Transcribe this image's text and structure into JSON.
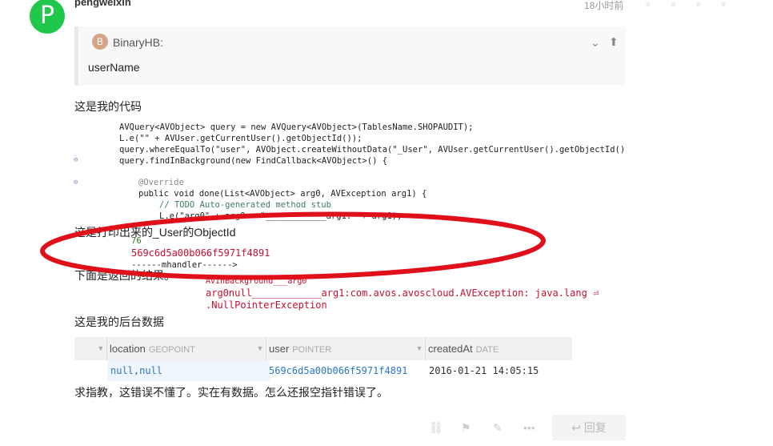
{
  "post": {
    "avatar_letter": "P",
    "username": "pengweixin",
    "timestamp": "18小时前",
    "quote": {
      "avatar_letter": "B",
      "author": "BinaryHB:",
      "body": "userName"
    },
    "para1": "这是我的代码",
    "code_lines": [
      "AVQuery<AVObject> query = new AVQuery<AVObject>(TablesName.SHOPAUDIT);",
      "L.e(\"\" + AVUser.getCurrentUser().getObjectId());",
      "query.whereEqualTo(\"user\", AVObject.createWithoutData(\"_User\", AVUser.getCurrentUser().getObjectId()));",
      "query.findInBackground(new FindCallback<AVObject>() {",
      "@Override",
      "public void done(List<AVObject> arg0, AVException arg1) {",
      "// TODO Auto-generated method stub",
      "L.e(\"arg0\" + arg0 + \"____________arg1:\" + arg1);"
    ],
    "para2": "这是打印出来的_User的ObjectId",
    "log_number": "76",
    "log_objectid": "569c6d5a00b066f5971f4891",
    "log_handler": "------mhandler------>",
    "para3": "下面是返回的结果。",
    "log_arg0": "AVInBackground___arg0",
    "log_error_1": "arg0null____________arg1:com.avos.avoscloud.AVException: java.lang ⏎",
    "log_error_2": ".NullPointerException",
    "para4": "这是我的后台数据",
    "table": {
      "columns": [
        {
          "name": "location",
          "type": "GEOPOINT"
        },
        {
          "name": "user",
          "type": "POINTER"
        },
        {
          "name": "createdAt",
          "type": "DATE"
        }
      ],
      "row": [
        "null,null",
        "569c6d5a00b066f5971f4891",
        "2016-01-21 14:05:15"
      ]
    },
    "para5": "求指教，这错误不懂了。实在有数据。怎么还报空指针错误了。",
    "reply_label": "回复"
  },
  "colors": {
    "avatar_green": "#1fc84b",
    "annotation_red": "#e0101a",
    "link_blue": "#2a77c8"
  },
  "icons": [
    "chevron-down-icon",
    "arrow-up-icon",
    "link-icon",
    "flag-icon",
    "pencil-icon",
    "more-icon",
    "reply-icon"
  ]
}
